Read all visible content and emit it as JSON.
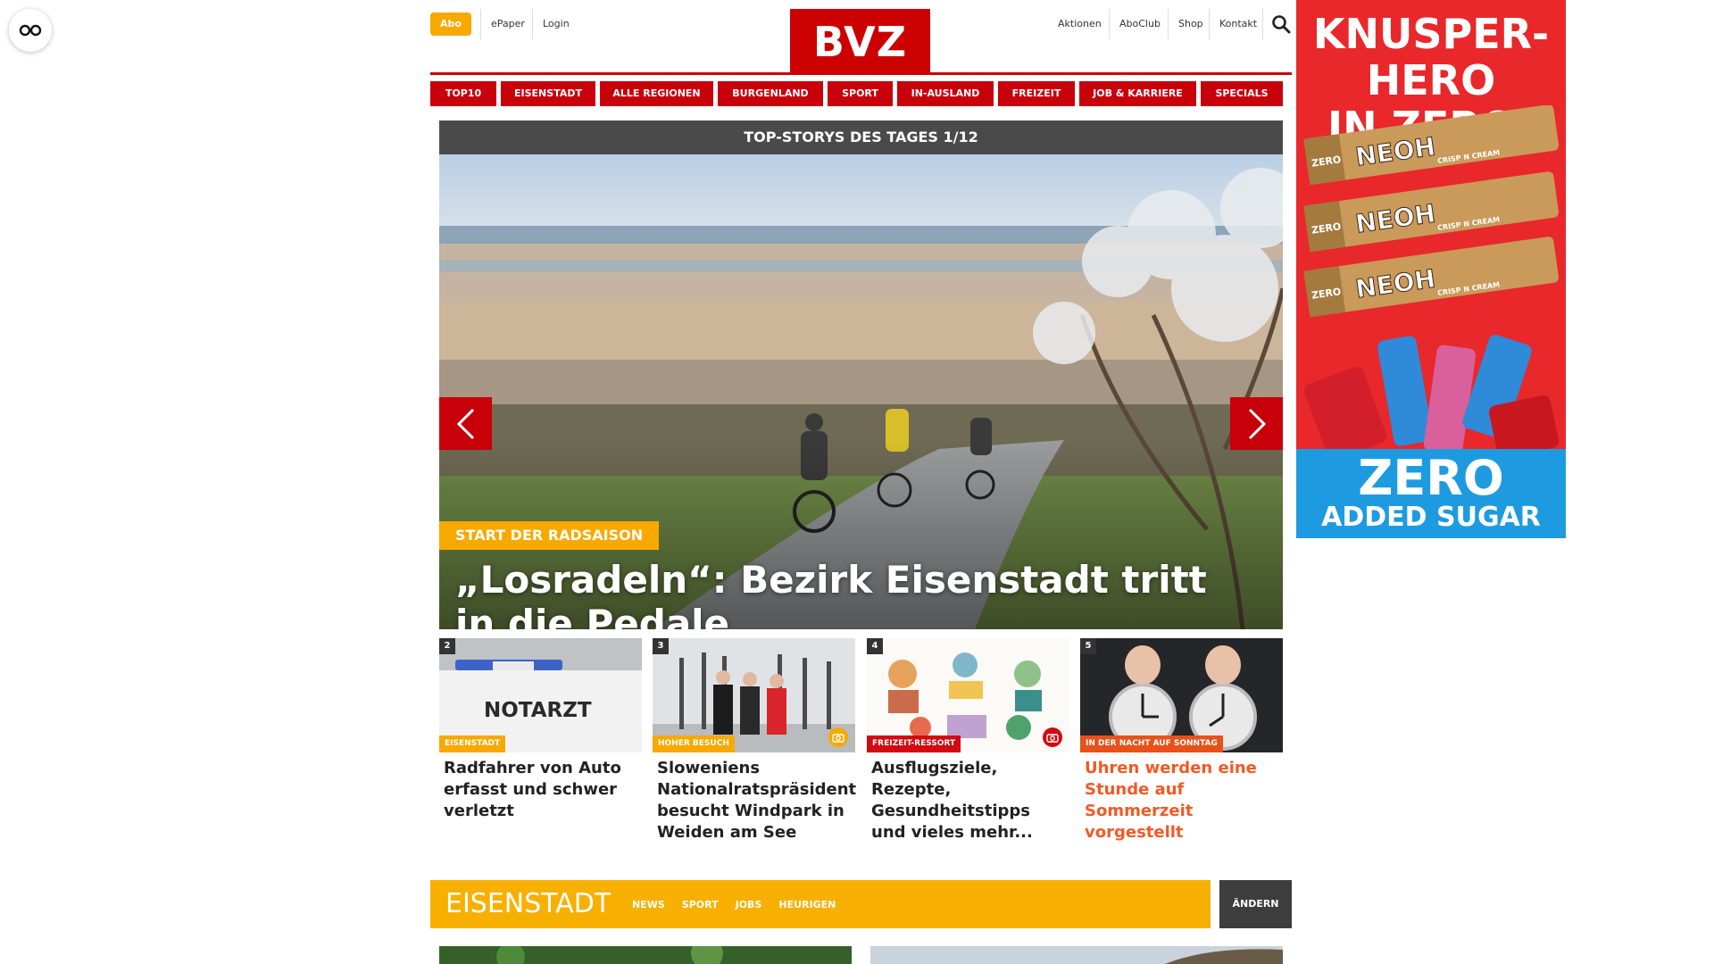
{
  "header": {
    "abo_label": "Abo",
    "epaper_label": "ePaper",
    "login_label": "Login",
    "logo_text": "BVZ",
    "aktionen_label": "Aktionen",
    "aboclub_label": "AboClub",
    "shop_label": "Shop",
    "kontakt_label": "Kontakt"
  },
  "nav": {
    "items": [
      "TOP10",
      "EISENSTADT",
      "ALLE REGIONEN",
      "BURGENLAND",
      "SPORT",
      "IN-AUSLAND",
      "FREIZEIT",
      "JOB & KARRIERE",
      "SPECIALS"
    ]
  },
  "hero": {
    "header": "TOP-STORYS DES TAGES 1/12",
    "kicker": "START DER RADSAISON",
    "title": "„Losradeln“: Bezirk Eisenstadt tritt in die Pedale"
  },
  "teasers": [
    {
      "num": "2",
      "tag": "EISENSTADT",
      "title": "Radfahrer von Auto erfasst und schwer verletzt",
      "tag_color": "#f7a900",
      "title_color": "#222222",
      "photo_label": "NOTARZT"
    },
    {
      "num": "3",
      "tag": "HOHER BESUCH",
      "title": "Sloweniens Nationalratspräsident besucht Windpark in Weiden am See",
      "tag_color": "#f7a900",
      "title_color": "#222222"
    },
    {
      "num": "4",
      "tag": "FREIZEIT-RESSORT",
      "title": "Ausflugsziele, Rezepte, Gesundheitstipps und vieles mehr...",
      "tag_color": "#d20a11",
      "title_color": "#222222"
    },
    {
      "num": "5",
      "tag": "IN DER NACHT AUF SONNTAG",
      "title": "Uhren werden eine Stunde auf Sommerzeit vorgestellt",
      "tag_color": "#e8511a",
      "title_color": "#f15a24"
    }
  ],
  "section": {
    "title": "EISENSTADT",
    "links": [
      "NEWS",
      "SPORT",
      "JOBS",
      "HEURIGEN"
    ],
    "change_label": "ÄNDERN"
  },
  "ad": {
    "headline_line1": "KNUSPER-HERO",
    "headline_line2": "IN ZERO!",
    "bar_brand": "NEOH",
    "bar_side": "ZERO",
    "bar_sub": "CRISP N CREAM",
    "footer_line1": "ZERO",
    "footer_line2": "ADDED SUGAR"
  },
  "colors": {
    "brand_red": "#c8000a",
    "accent_yellow": "#f7a900",
    "dark_gray": "#4a4a4a"
  }
}
